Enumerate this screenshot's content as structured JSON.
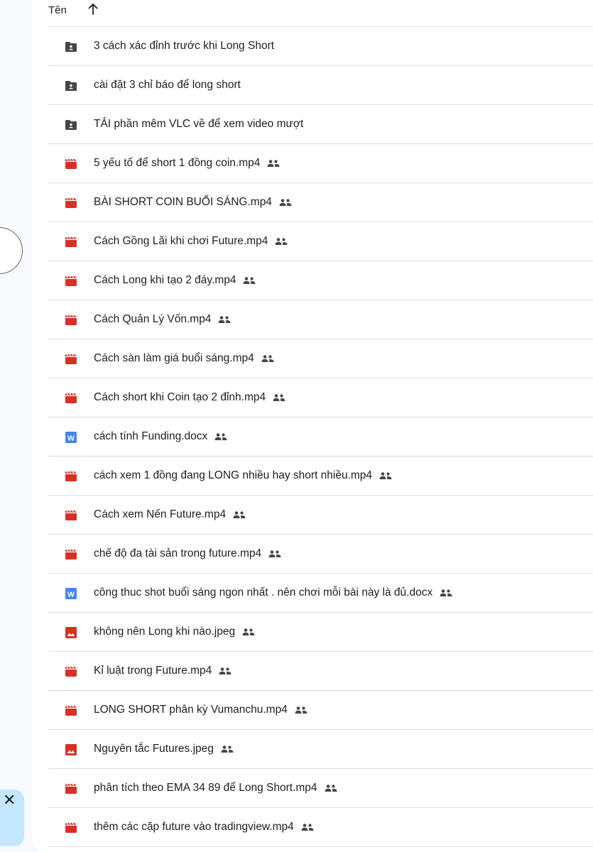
{
  "header": {
    "name_label": "Tên",
    "sort_icon": "arrow-up-icon"
  },
  "sidebar": {
    "close_label": "✕"
  },
  "colors": {
    "folder": "#444746",
    "video": "#d93025",
    "image": "#d93025",
    "doc": "#4285f4"
  },
  "files": [
    {
      "name": "3 cách xác đỉnh trước khi Long Short",
      "type": "folder",
      "shared": false
    },
    {
      "name": "cài đặt 3 chỉ báo để long short",
      "type": "folder",
      "shared": false
    },
    {
      "name": "TẢI phần mêm VLC về để xem video mượt",
      "type": "folder",
      "shared": false
    },
    {
      "name": "5 yếu tố để short 1 đồng coin.mp4",
      "type": "video",
      "shared": true
    },
    {
      "name": "BÀI SHORT COIN BUỔI SÁNG.mp4",
      "type": "video",
      "shared": true
    },
    {
      "name": "Cách Gồng Lãi khi chơi Future.mp4",
      "type": "video",
      "shared": true
    },
    {
      "name": "Cách Long khi tạo 2 đáy.mp4",
      "type": "video",
      "shared": true
    },
    {
      "name": "Cách Quản Lý Vốn.mp4",
      "type": "video",
      "shared": true
    },
    {
      "name": "Cách sàn làm giá buổi sáng.mp4",
      "type": "video",
      "shared": true
    },
    {
      "name": "Cách short khi Coin tạo 2 đỉnh.mp4",
      "type": "video",
      "shared": true
    },
    {
      "name": "cách tính Funding.docx",
      "type": "doc",
      "shared": true
    },
    {
      "name": "cách xem 1 đồng đang LONG nhiều hay short nhiều.mp4",
      "type": "video",
      "shared": true
    },
    {
      "name": "Cách xem Nến Future.mp4",
      "type": "video",
      "shared": true
    },
    {
      "name": "chế độ đa tài sản trong future.mp4",
      "type": "video",
      "shared": true
    },
    {
      "name": "công thuc shot buổi sáng ngon nhất . nên chơi mỗi bài này là đủ.docx",
      "type": "doc",
      "shared": true
    },
    {
      "name": "không nên Long khi nào.jpeg",
      "type": "image",
      "shared": true
    },
    {
      "name": "Kỉ luật trong Future.mp4",
      "type": "video",
      "shared": true
    },
    {
      "name": "LONG SHORT phân kỳ Vumanchu.mp4",
      "type": "video",
      "shared": true
    },
    {
      "name": "Nguyên tắc Futures.jpeg",
      "type": "image",
      "shared": true
    },
    {
      "name": "phân tích theo EMA 34 89 để Long Short.mp4",
      "type": "video",
      "shared": true
    },
    {
      "name": "thêm các cặp future vào tradingview.mp4",
      "type": "video",
      "shared": true
    }
  ]
}
